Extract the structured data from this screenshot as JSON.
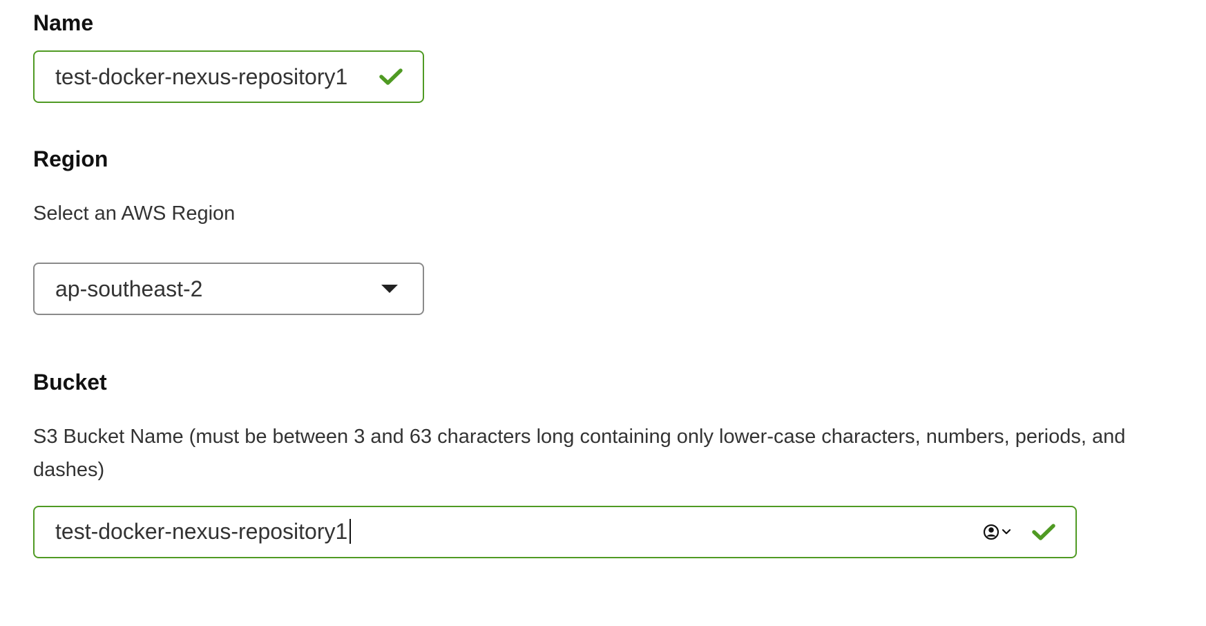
{
  "form": {
    "name": {
      "label": "Name",
      "value": "test-docker-nexus-repository1",
      "status_icon": "check-icon"
    },
    "region": {
      "label": "Region",
      "description": "Select an AWS Region",
      "selected": "ap-southeast-2",
      "toggle_icon": "caret-down-icon"
    },
    "bucket": {
      "label": "Bucket",
      "description": "S3 Bucket Name (must be between 3 and 63 characters long containing only lower-case characters, numbers, periods, and dashes)",
      "value": "test-docker-nexus-repository1",
      "autofill_icon": "user-circle-icon",
      "status_icon": "check-icon"
    }
  },
  "colors": {
    "valid_border": "#4f9a23",
    "valid_check": "#4f9a23",
    "neutral_border": "#8a8a8a",
    "text": "#333333",
    "label": "#111111"
  }
}
